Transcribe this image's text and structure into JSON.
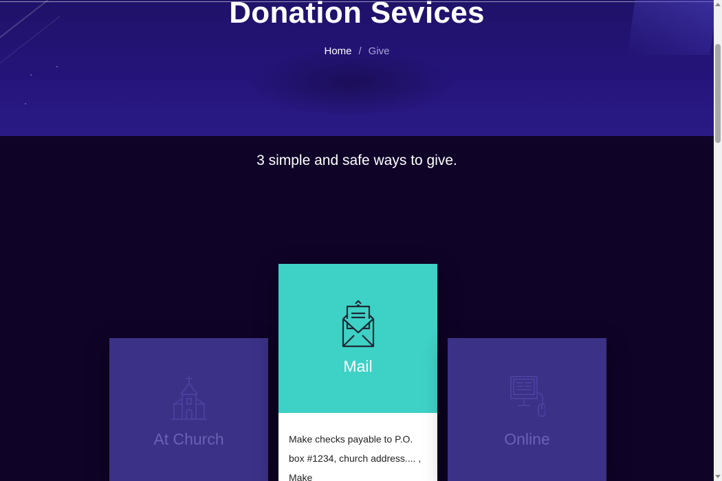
{
  "hero": {
    "title": "Donation Sevices",
    "breadcrumb": {
      "home": "Home",
      "separator": "/",
      "current": "Give"
    }
  },
  "intro": {
    "tagline": "3 simple and safe ways to give."
  },
  "cards": [
    {
      "label": "At Church",
      "icon": "church-icon"
    },
    {
      "label": "Mail",
      "icon": "mail-envelope-icon",
      "description": "Make checks payable to P.O. box #1234, church address.... , Make"
    },
    {
      "label": "Online",
      "icon": "computer-icon"
    }
  ],
  "colors": {
    "hero_bg": "#24147a",
    "page_bg": "#0f0328",
    "card_bg": "#3b3187",
    "accent_teal": "#3ed1c6",
    "card_label_muted": "#6a62b2"
  }
}
